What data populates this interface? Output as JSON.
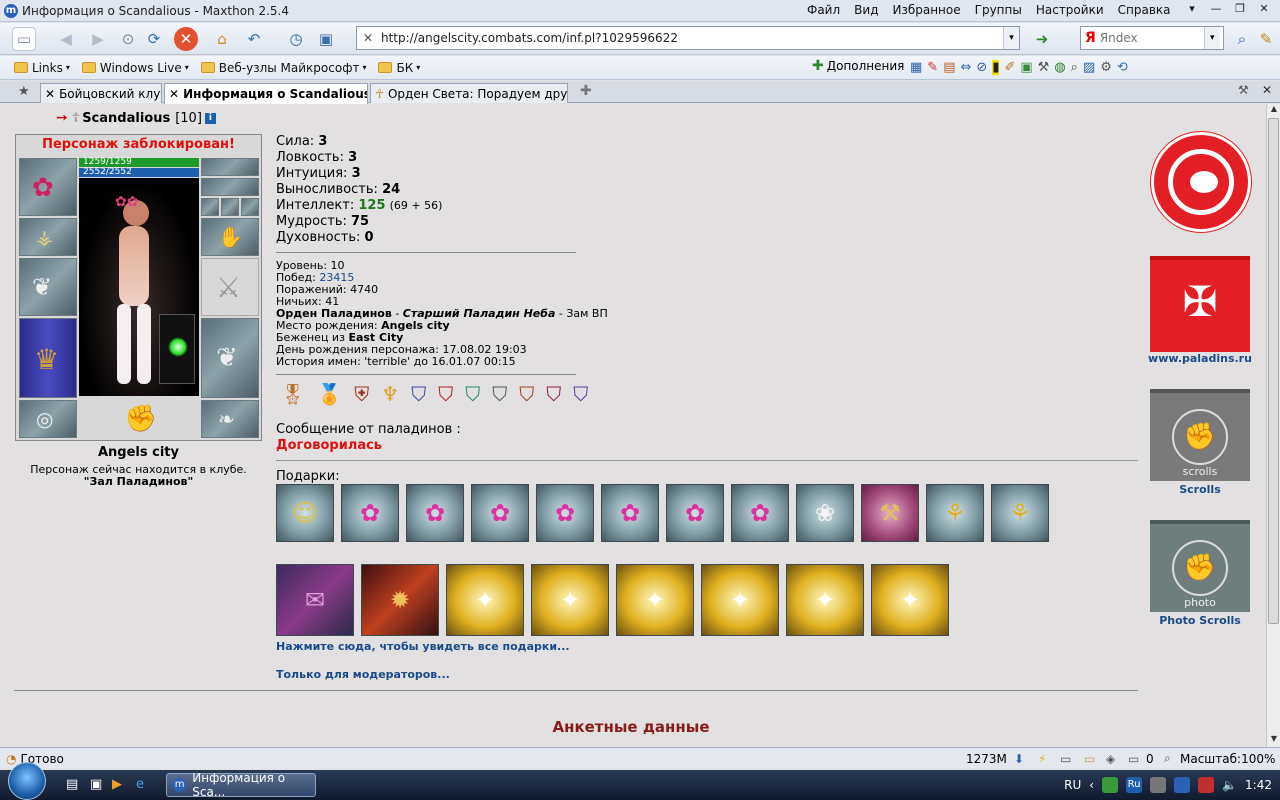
{
  "window": {
    "title": "Информация о Scandalious - Maxthon 2.5.4",
    "menu": [
      "Файл",
      "Вид",
      "Избранное",
      "Группы",
      "Настройки",
      "Справка"
    ]
  },
  "toolbar": {
    "url": "http://angelscity.combats.com/inf.pl?1029596622",
    "search_placeholder": "Яndex",
    "search_brand": "Я"
  },
  "links_bar": {
    "items": [
      "Links",
      "Windows Live",
      "Веб-узлы Майкрософт",
      "БК"
    ],
    "addons_label": "Дополнения"
  },
  "tabs": [
    {
      "label": "Бойцовский клуб"
    },
    {
      "label": "Информация о Scandalious"
    },
    {
      "label": "Орден Света: Порадуем друз..."
    }
  ],
  "character": {
    "name": "Scandalious",
    "level_badge": "[10]",
    "blocked": "Персонаж заблокирован!",
    "hp": "1259/1259",
    "mana": "2552/2552",
    "city": "Angels city",
    "location_text": "Персонаж сейчас находится в клубе.",
    "location_place": "\"Зал Паладинов\""
  },
  "stats": [
    {
      "label": "Сила:",
      "value": "3",
      "extra": ""
    },
    {
      "label": "Ловкость:",
      "value": "3",
      "extra": ""
    },
    {
      "label": "Интуиция:",
      "value": "3",
      "extra": ""
    },
    {
      "label": "Выносливость:",
      "value": "24",
      "extra": ""
    },
    {
      "label": "Интеллект:",
      "value": "125",
      "extra": "(69 + 56)"
    },
    {
      "label": "Мудрость:",
      "value": "75",
      "extra": ""
    },
    {
      "label": "Духовность:",
      "value": "0",
      "extra": ""
    }
  ],
  "info": {
    "level": "Уровень: 10",
    "wins_label": "Побед:",
    "wins": "23415",
    "losses": "Поражений: 4740",
    "draws": "Ничьих: 41",
    "order_name": "Орден Паладинов",
    "order_sep": " - ",
    "order_rank": "Старший Паладин Неба",
    "order_extra": " - Зам ВП",
    "birthplace_label": "Место рождения:",
    "birthplace": "Angels city",
    "refugee_label": "Беженец из",
    "refugee": "East City",
    "birthday": "День рождения персонажа: 17.08.02 19:03",
    "names_history": "История имен: 'terrible' до 16.01.07 00:15"
  },
  "message": {
    "header": "Сообщение от паладинов :",
    "text": "Договорилась"
  },
  "gifts": {
    "header": "Подарки:",
    "row1": [
      "smiley-badge",
      "orchid",
      "orchid",
      "orchid",
      "orchid",
      "orchid",
      "orchid",
      "orchid",
      "white-bouquet",
      "golden-hammer",
      "golden-rose",
      "golden-rose"
    ],
    "row2": [
      "birthday-card",
      "fire-card",
      "golden-card",
      "golden-card",
      "golden-card",
      "golden-card",
      "golden-card",
      "golden-card"
    ],
    "show_all": "Нажмите сюда, чтобы увидеть все подарки...",
    "moderators": "Только для модераторов..."
  },
  "anketa_header": "Анкетные данные",
  "sidebar": {
    "paladins_link": "www.paladins.ru",
    "scrolls_link": "Scrolls",
    "scrolls_banner": "scrolls",
    "photo_link": "Photo Scrolls",
    "photo_banner": "photo"
  },
  "statusbar": {
    "status": "Готово",
    "memory": "1273M",
    "counter": "0",
    "zoom": "Масштаб:100%"
  },
  "taskbar": {
    "task": "Информация о Sca...",
    "lang": "RU",
    "tray_lang": "Ru",
    "clock": "1:42"
  },
  "colors": {
    "blocked_red": "#e01010",
    "link_blue": "#1b4a8a",
    "green_value": "#1a7a1a",
    "anketa_red": "#8a1a1a",
    "paladin_red": "#e31e24",
    "hp_green": "#1f9a2a",
    "mana_blue": "#1e5fb0"
  }
}
